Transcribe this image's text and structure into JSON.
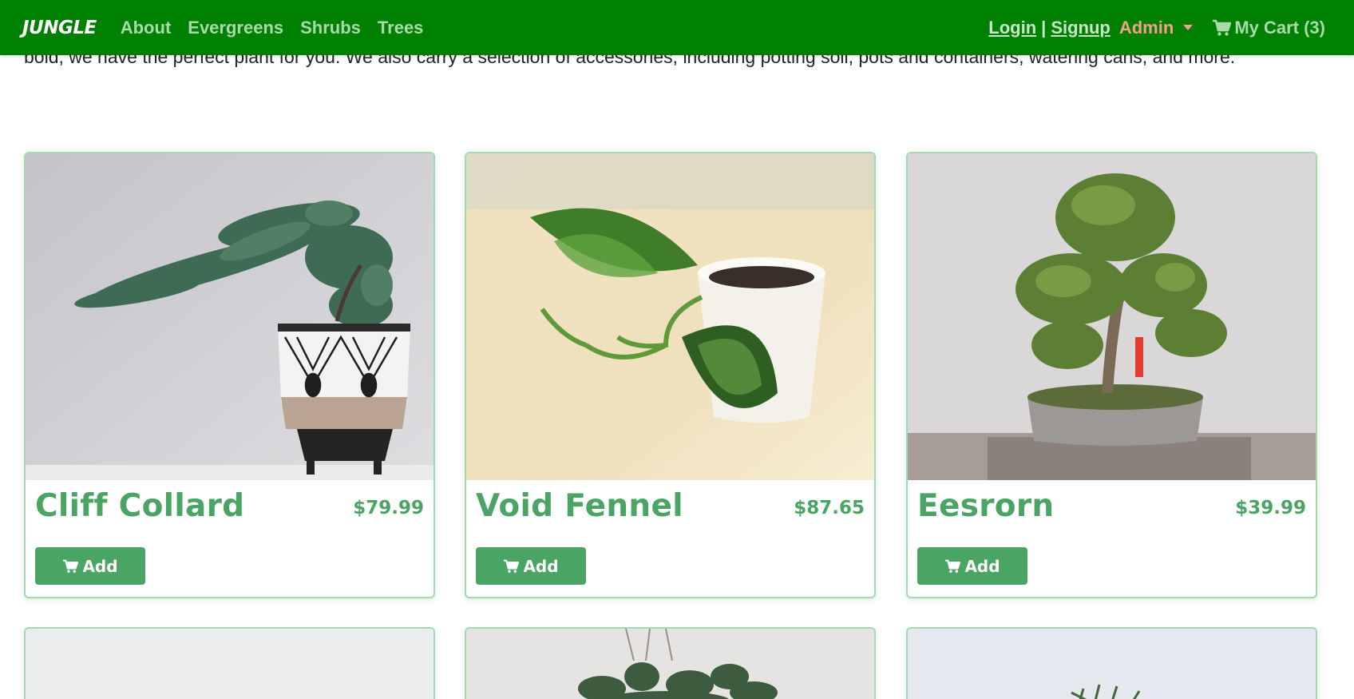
{
  "navbar": {
    "brand": "JUNGLE",
    "links": [
      "About",
      "Evergreens",
      "Shrubs",
      "Trees"
    ],
    "login": "Login",
    "separator": "|",
    "signup": "Signup",
    "admin": "Admin",
    "cart": "My Cart (3)",
    "icons": {
      "cart": "shopping-cart-icon",
      "admin_toggle": "caret-down-icon"
    }
  },
  "intro": {
    "text": "bold, we have the perfect plant for you. We also carry a selection of accessories, including potting soil, pots and containers, watering cans, and more."
  },
  "products": [
    {
      "name": "Cliff Collard",
      "price": "$79.99",
      "button": "Add"
    },
    {
      "name": "Void Fennel",
      "price": "$87.65",
      "button": "Add"
    },
    {
      "name": "Eesrorn",
      "price": "$39.99",
      "button": "Add"
    }
  ],
  "colors": {
    "navbar": "#008000",
    "nav_link": "#a9dba9",
    "admin": "#f4a08e",
    "product_accent": "#4aa564",
    "card_border": "#a3d9b1"
  }
}
